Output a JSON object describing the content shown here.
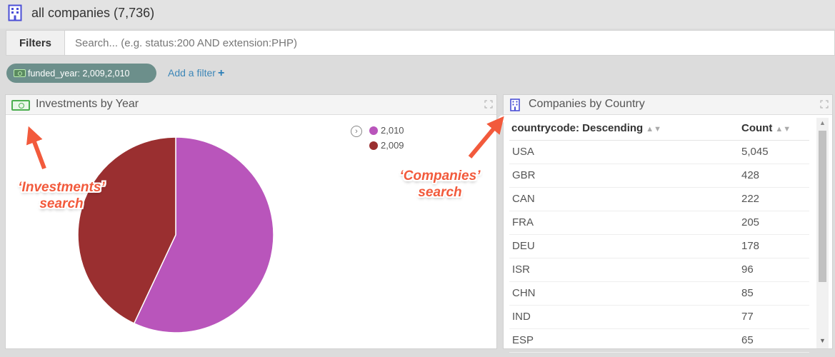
{
  "header": {
    "title": "all companies (7,736)",
    "icon": "building-icon"
  },
  "filter_bar": {
    "button_label": "Filters",
    "search_placeholder": "Search... (e.g. status:200 AND extension:PHP)",
    "search_value": ""
  },
  "active_filter": {
    "label": "funded_year: 2,009,2,010",
    "icon": "money-icon"
  },
  "add_filter": {
    "label": "Add a filter",
    "plus": "+"
  },
  "investments_panel": {
    "title": "Investments by Year",
    "icon": "money-icon",
    "chart_data": {
      "type": "pie",
      "slices": [
        {
          "label": "2,010",
          "value": 57,
          "color": "#b955bb"
        },
        {
          "label": "2,009",
          "value": 43,
          "color": "#9a2f30"
        }
      ],
      "legend_placement": "top-right"
    }
  },
  "companies_panel": {
    "title": "Companies by Country",
    "icon": "building-icon",
    "columns": [
      "countrycode: Descending",
      "Count"
    ],
    "rows": [
      [
        "USA",
        "5,045"
      ],
      [
        "GBR",
        "428"
      ],
      [
        "CAN",
        "222"
      ],
      [
        "FRA",
        "205"
      ],
      [
        "DEU",
        "178"
      ],
      [
        "ISR",
        "96"
      ],
      [
        "CHN",
        "85"
      ],
      [
        "IND",
        "77"
      ],
      [
        "ESP",
        "65"
      ]
    ]
  },
  "annotations": {
    "investments_line1": "‘Investments’",
    "investments_line2": "search",
    "companies_line1": "‘Companies’",
    "companies_line2": "search"
  },
  "colors": {
    "accent": "#3d87b8",
    "annotation": "#f25a3c",
    "chip": "#6c8f8b"
  }
}
